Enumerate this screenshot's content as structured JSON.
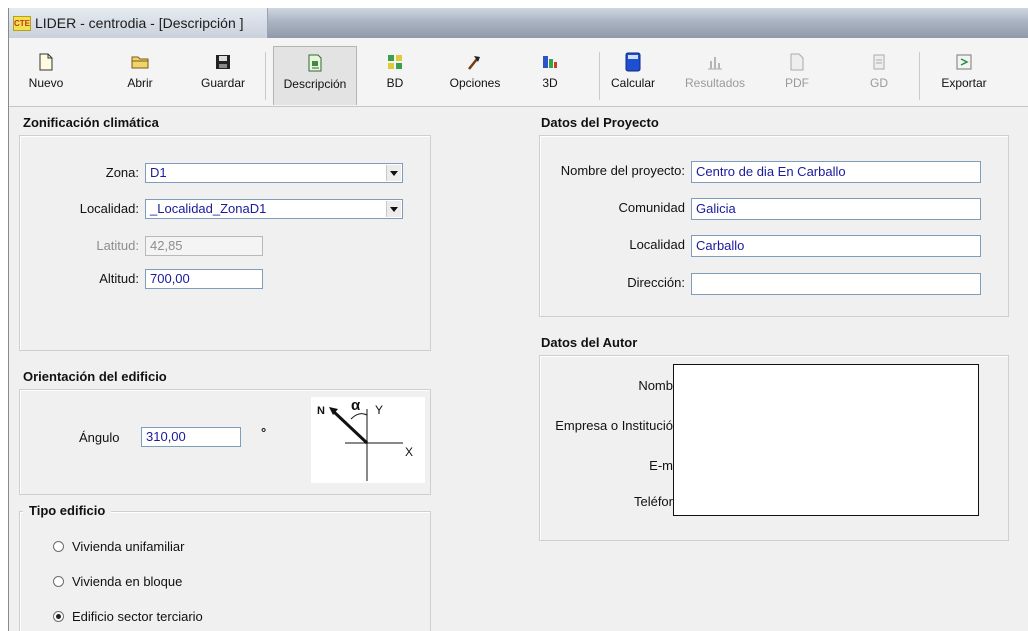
{
  "window": {
    "app_icon": "CTE",
    "title": "LIDER - centrodia - [Descripción ]"
  },
  "toolbar": {
    "items": [
      {
        "label": "Nuevo",
        "icon": "new-file-icon"
      },
      {
        "label": "Abrir",
        "icon": "open-folder-icon"
      },
      {
        "label": "Guardar",
        "icon": "floppy-disk-icon"
      },
      {
        "label": "Descripción",
        "icon": "description-icon"
      },
      {
        "label": "BD",
        "icon": "database-icon"
      },
      {
        "label": "Opciones",
        "icon": "hammer-icon"
      },
      {
        "label": "3D",
        "icon": "3d-view-icon"
      },
      {
        "label": "Calcular",
        "icon": "calculator-icon"
      },
      {
        "label": "Resultados",
        "icon": "results-chart-icon"
      },
      {
        "label": "PDF",
        "icon": "pdf-icon"
      },
      {
        "label": "GD",
        "icon": "gd-icon"
      },
      {
        "label": "Exportar",
        "icon": "export-icon"
      }
    ],
    "active": "Descripción",
    "disabled": [
      "Resultados",
      "PDF",
      "GD"
    ],
    "colors": {
      "calculator": "#1f4fd1",
      "bd": "#3aa04a",
      "hammer": "#c0392b"
    }
  },
  "zonificacion": {
    "title": "Zonificación climática",
    "zona_label": "Zona:",
    "zona_value": "D1",
    "localidad_label": "Localidad:",
    "localidad_value": "_Localidad_ZonaD1",
    "latitud_label": "Latitud:",
    "latitud_value": "42,85",
    "altitud_label": "Altitud:",
    "altitud_value": "700,00"
  },
  "orientacion": {
    "title": "Orientación del edificio",
    "angulo_label": "Ángulo",
    "angulo_value": "310,00",
    "unit": "°",
    "diagram": {
      "n": "N",
      "alpha": "α",
      "y": "Y",
      "x": "X"
    }
  },
  "tipo_edificio": {
    "title": "Tipo edificio",
    "options": [
      "Vivienda unifamiliar",
      "Vivienda en bloque",
      "Edificio sector terciario"
    ],
    "selected": "Edificio sector terciario"
  },
  "proyecto": {
    "title": "Datos del Proyecto",
    "nombre_label": "Nombre del proyecto:",
    "nombre_value": "Centro de dia En Carballo",
    "comunidad_label": "Comunidad",
    "comunidad_value": "Galicia",
    "localidad_label": "Localidad",
    "localidad_value": "Carballo",
    "direccion_label": "Dirección:",
    "direccion_value": ""
  },
  "autor": {
    "title": "Datos del Autor",
    "nombre_label": "Nomb",
    "empresa_label": "Empresa o Institució",
    "email_label": "E-m",
    "telefono_label": "Teléfor"
  }
}
